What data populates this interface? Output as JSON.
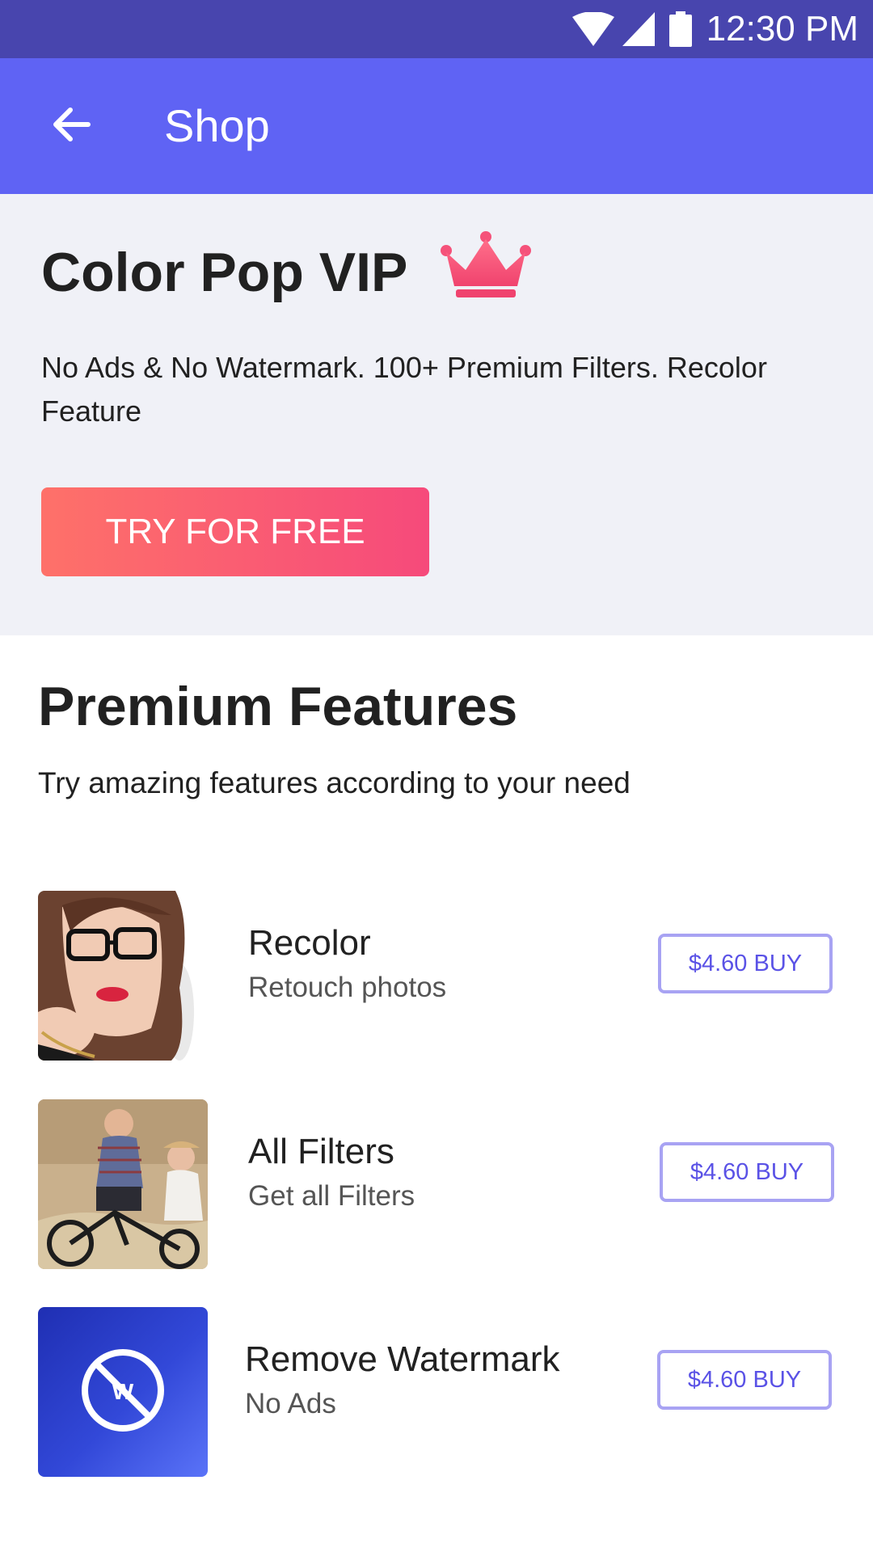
{
  "status_bar": {
    "time": "12:30 PM",
    "icons": [
      "wifi-icon",
      "cell-signal-icon",
      "battery-icon"
    ]
  },
  "app_bar": {
    "title": "Shop",
    "back_icon": "arrow-left-icon"
  },
  "vip": {
    "title": "Color Pop VIP",
    "crown_icon": "crown-icon",
    "description": "No Ads & No Watermark. 100+ Premium Filters. Recolor Feature",
    "cta_label": "TRY FOR FREE"
  },
  "premium": {
    "title": "Premium Features",
    "subtitle": "Try amazing features according to your need",
    "items": [
      {
        "name": "Recolor",
        "description": "Retouch photos",
        "buy_label": "$4.60 BUY"
      },
      {
        "name": "All Filters",
        "description": "Get all Filters",
        "buy_label": "$4.60 BUY"
      },
      {
        "name": "Remove Watermark",
        "description": "No Ads",
        "buy_label": "$4.60 BUY",
        "icon_letter": "W"
      }
    ]
  },
  "colors": {
    "status_bar": "#4845ae",
    "app_bar": "#5f63f4",
    "vip_background": "#f0f1f7",
    "cta_gradient_start": "#fe7169",
    "cta_gradient_end": "#f64a7b",
    "buy_border": "#a8a3f3",
    "buy_text": "#5a52e6"
  }
}
